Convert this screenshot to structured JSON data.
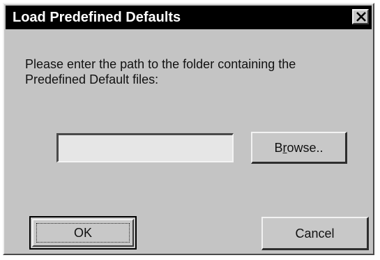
{
  "dialog": {
    "title": "Load Predefined Defaults",
    "close_icon": "close-x-icon",
    "prompt": "Please enter the path to the folder containing the Predefined Default files:",
    "path_input": {
      "value": "",
      "placeholder": ""
    },
    "browse_button": {
      "label_prefix": "B",
      "label_mnemonic": "r",
      "label_suffix": "owse.."
    },
    "ok_label": "OK",
    "cancel_label": "Cancel"
  }
}
